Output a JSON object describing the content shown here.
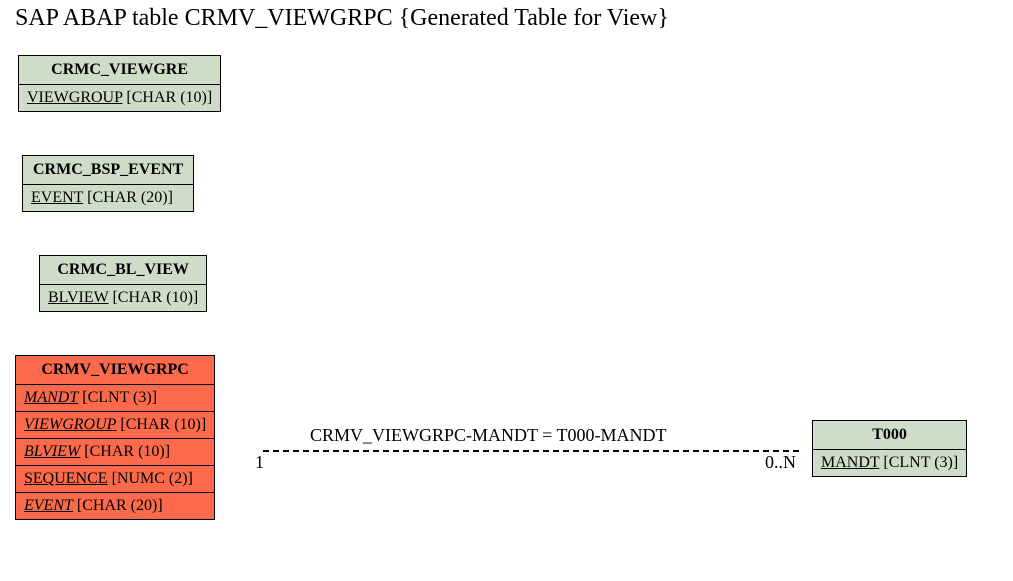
{
  "title": "SAP ABAP table CRMV_VIEWGRPC {Generated Table for View}",
  "entities": {
    "e1": {
      "name": "CRMC_VIEWGRE",
      "fields": [
        {
          "field": "VIEWGROUP",
          "type": " [CHAR (10)]",
          "key": false
        }
      ]
    },
    "e2": {
      "name": "CRMC_BSP_EVENT",
      "fields": [
        {
          "field": "EVENT",
          "type": " [CHAR (20)]",
          "key": false
        }
      ]
    },
    "e3": {
      "name": "CRMC_BL_VIEW",
      "fields": [
        {
          "field": "BLVIEW",
          "type": " [CHAR (10)]",
          "key": false
        }
      ]
    },
    "e4": {
      "name": "CRMV_VIEWGRPC",
      "fields": [
        {
          "field": "MANDT",
          "type": " [CLNT (3)]",
          "key": true
        },
        {
          "field": "VIEWGROUP",
          "type": " [CHAR (10)]",
          "key": true
        },
        {
          "field": "BLVIEW",
          "type": " [CHAR (10)]",
          "key": true
        },
        {
          "field": "SEQUENCE",
          "type": " [NUMC (2)]",
          "key": false
        },
        {
          "field": "EVENT",
          "type": " [CHAR (20)]",
          "key": true
        }
      ]
    },
    "e5": {
      "name": "T000",
      "fields": [
        {
          "field": "MANDT",
          "type": " [CLNT (3)]",
          "key": false
        }
      ]
    }
  },
  "relation": {
    "label": "CRMV_VIEWGRPC-MANDT = T000-MANDT",
    "card_left": "1",
    "card_right": "0..N"
  }
}
